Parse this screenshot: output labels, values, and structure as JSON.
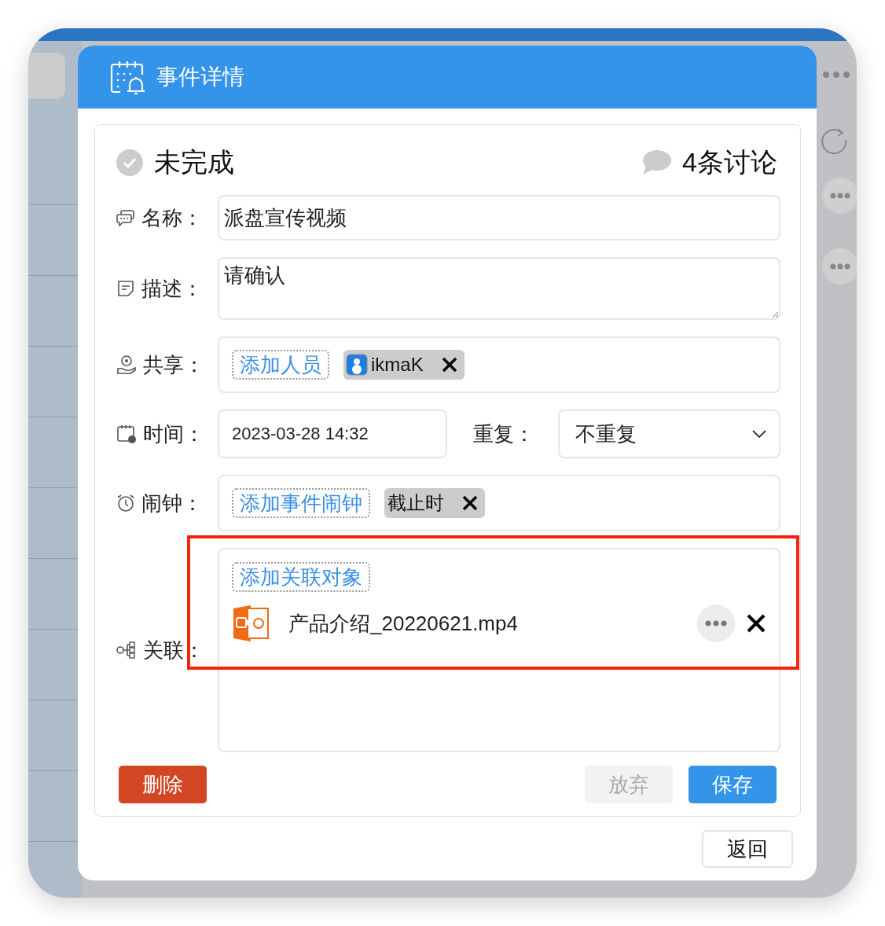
{
  "dialog": {
    "title": "事件详情"
  },
  "status": {
    "label": "未完成",
    "completed": false
  },
  "discussion": {
    "label": "4条讨论"
  },
  "name_field": {
    "label": "名称：",
    "value": "派盘宣传视频"
  },
  "description_field": {
    "label": "描述：",
    "value": "请确认"
  },
  "share_field": {
    "label": "共享：",
    "add_button": "添加人员",
    "members": [
      {
        "name": "ikmaK"
      }
    ]
  },
  "time_field": {
    "label": "时间：",
    "value": "2023-03-28 14:32"
  },
  "repeat_field": {
    "label": "重复：",
    "value": "不重复"
  },
  "alarm_field": {
    "label": "闹钟：",
    "add_button": "添加事件闹钟",
    "alarms": [
      {
        "name": "截止时"
      }
    ]
  },
  "relation_field": {
    "label": "关联：",
    "add_button": "添加关联对象",
    "items": [
      {
        "name": "产品介绍_20220621.mp4"
      }
    ]
  },
  "buttons": {
    "delete": {
      "label": "删除"
    },
    "abandon": {
      "label": "放弃",
      "disabled": true
    },
    "save": {
      "label": "保存"
    },
    "back": {
      "label": "返回"
    }
  }
}
